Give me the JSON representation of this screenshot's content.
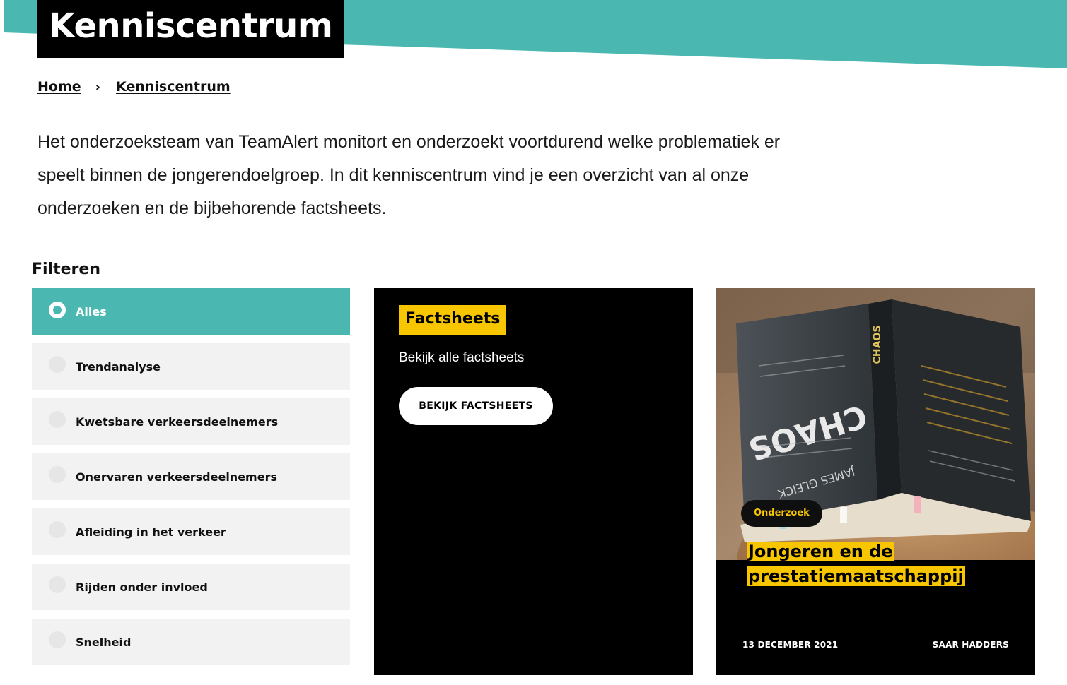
{
  "header": {
    "title": "Kenniscentrum"
  },
  "breadcrumb": {
    "home": "Home",
    "separator": "›",
    "current": "Kenniscentrum"
  },
  "intro": {
    "text": "Het onderzoeksteam van TeamAlert monitort en onderzoekt voortdurend welke problematiek er speelt binnen de jongerendoelgroep. In dit kenniscentrum vind je een overzicht van al onze onderzoeken en de bijbehorende factsheets."
  },
  "filter": {
    "heading": "Filteren",
    "items": [
      {
        "label": "Alles",
        "selected": true
      },
      {
        "label": "Trendanalyse",
        "selected": false
      },
      {
        "label": "Kwetsbare verkeersdeelnemers",
        "selected": false
      },
      {
        "label": "Onervaren verkeersdeelnemers",
        "selected": false
      },
      {
        "label": "Afleiding in het verkeer",
        "selected": false
      },
      {
        "label": "Rijden onder invloed",
        "selected": false
      },
      {
        "label": "Snelheid",
        "selected": false
      }
    ]
  },
  "factsheets_card": {
    "tag": "Factsheets",
    "text": "Bekijk alle factsheets",
    "button_label": "BEKIJK FACTSHEETS"
  },
  "article_card": {
    "badge": "Onderzoek",
    "title": "Jongeren en de prestatiemaatschappij",
    "date": "13 DECEMBER 2021",
    "author": "SAAR HADDERS",
    "book_title": "CHAOS",
    "book_author": "JAMES GLEICK"
  },
  "colors": {
    "teal": "#4ab8b1",
    "yellow": "#f7c600",
    "black": "#000000",
    "filter_bg": "#f2f2f2"
  }
}
